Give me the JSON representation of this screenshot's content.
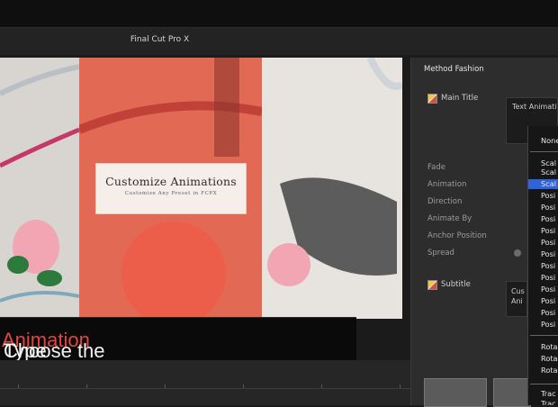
{
  "app": {
    "title": "Final Cut Pro X"
  },
  "viewer": {
    "title_card": {
      "main": "Customize Animations",
      "sub": "Customize Any Preset in FCPX"
    }
  },
  "caption": {
    "prefix": "Choose the ",
    "highlight": "Animation",
    "suffix": " Type"
  },
  "inspector": {
    "title": "Method Fashion",
    "main_title_label": "Main Title",
    "text_field": "Text Animati",
    "labels": [
      "Fade",
      "Animation",
      "Direction",
      "Animate By",
      "Anchor Position",
      "Spread"
    ],
    "subtitle_label": "Subtitle",
    "subtitle_field": [
      "Cus",
      "Ani"
    ]
  },
  "dropdown": {
    "items": [
      "None",
      "Scal",
      "Scal",
      "Scal",
      "Posi",
      "Posi",
      "Posi",
      "Posi",
      "Posi",
      "Posi",
      "Posi",
      "Posi",
      "Posi",
      "Posi",
      "Posi",
      "Posi",
      "Rota",
      "Rota",
      "Rota",
      "Trac",
      "Trac"
    ],
    "selected_index": 3
  },
  "colors": {
    "accent": "#e0463f",
    "selection": "#2f63d8"
  }
}
